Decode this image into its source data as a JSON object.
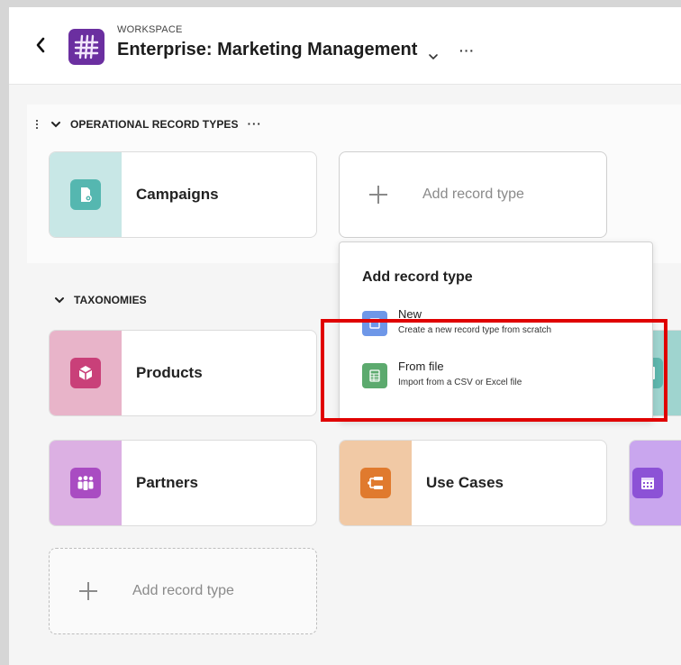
{
  "header": {
    "eyebrow": "WORKSPACE",
    "title": "Enterprise: Marketing Management",
    "more": "···"
  },
  "sections": {
    "operational": {
      "title": "OPERATIONAL RECORD TYPES",
      "more": "···",
      "cards": [
        {
          "label": "Campaigns",
          "icon": "document-gear-icon",
          "tile_color": "#c8e7e6",
          "icon_color": "#55b7b0"
        }
      ],
      "add_label": "Add record type"
    },
    "taxonomies": {
      "title": "TAXONOMIES",
      "cards": [
        {
          "label": "Products",
          "icon": "cube-icon",
          "tile_color": "#e8b4c9",
          "icon_color": "#c94079"
        },
        {
          "label": "Partners",
          "icon": "people-icon",
          "tile_color": "#dcb0e3",
          "icon_color": "#a94cc2"
        },
        {
          "label": "Use Cases",
          "icon": "flow-icon",
          "tile_color": "#f1c9a5",
          "icon_color": "#e07a2e"
        }
      ],
      "add_label": "Add record type"
    }
  },
  "popover": {
    "title": "Add record type",
    "items": [
      {
        "name": "New",
        "desc": "Create a new record type from scratch",
        "icon": "new-record-icon",
        "color": "#6e97e8"
      },
      {
        "name": "From file",
        "desc": "Import from a CSV or Excel file",
        "icon": "spreadsheet-icon",
        "color": "#5caa6e"
      }
    ]
  },
  "colors": {
    "workspace_icon": "#6b2fa0",
    "highlight": "#e00000",
    "calendar_tile": "#c9a6ee",
    "image_tile": "#9fd4cf"
  }
}
